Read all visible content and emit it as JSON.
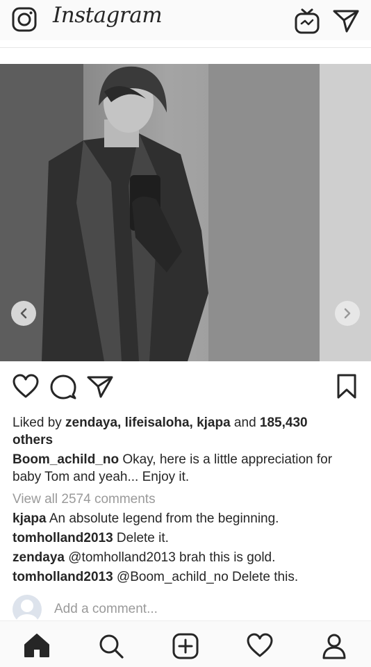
{
  "header": {
    "logo_text": "Instagram",
    "icons": [
      "camera-icon",
      "igtv-icon",
      "direct-message-icon"
    ]
  },
  "post": {
    "image_description_icon": "photo",
    "carousel": {
      "prev_icon": "chevron-left-icon",
      "next_icon": "chevron-right-icon"
    },
    "actions": [
      "like-heart-icon",
      "comment-icon",
      "share-icon",
      "bookmark-icon"
    ],
    "likes": {
      "prefix": "Liked by ",
      "users": "zendaya, lifeisaloha, kjapa",
      "middle": " and ",
      "count": "185,430",
      "suffix": "others"
    },
    "caption": {
      "username": "Boom_achild_no",
      "text": " Okay, here is a little appreciation for baby Tom and yeah... Enjoy it."
    },
    "view_all": "View all 2574 comments",
    "comments": [
      {
        "username": "kjapa",
        "text": " An absolute legend from the beginning."
      },
      {
        "username": "tomholland2013",
        "text": " Delete it."
      },
      {
        "username": "zendaya",
        "text": " @tomholland2013 brah this is gold."
      },
      {
        "username": "tomholland2013",
        "text": " @Boom_achild_no Delete this."
      }
    ],
    "add_comment_placeholder": "Add a comment..."
  },
  "bottom_nav": [
    "home-icon",
    "search-icon",
    "new-post-icon",
    "activity-icon",
    "profile-icon"
  ],
  "colors": {
    "text": "#262626",
    "muted": "#9a9a9a",
    "bar": "#fafafa"
  }
}
